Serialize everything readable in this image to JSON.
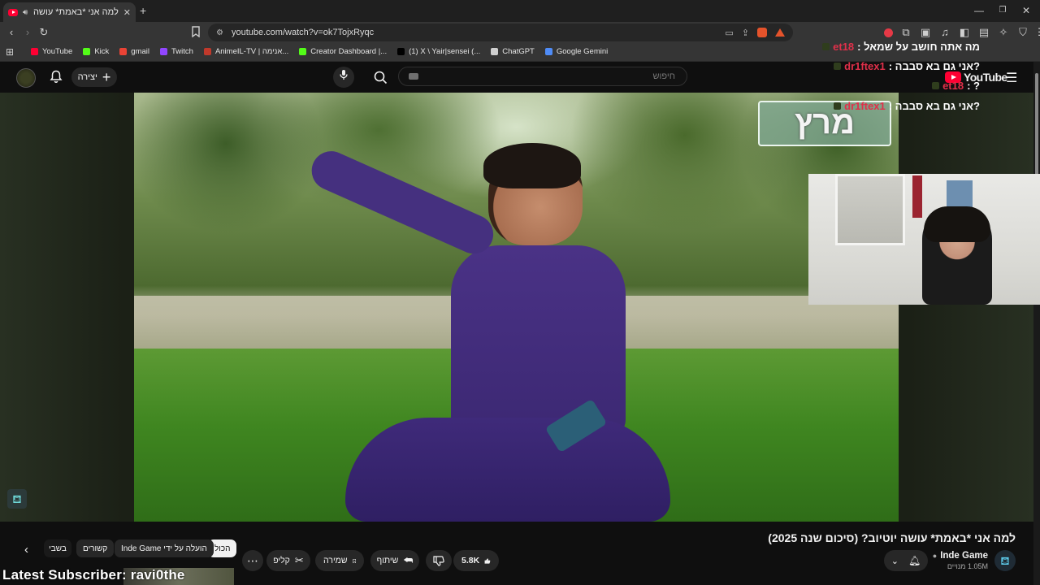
{
  "browser": {
    "tab_title": "למה אני *באמת* עושה יוטיוב?",
    "url": "youtube.com/watch?v=ok7TojxRyqc",
    "bookmarks": [
      {
        "label": "YouTube",
        "icon": "youtube-icon",
        "color": "#ff0033"
      },
      {
        "label": "Kick",
        "icon": "kick-icon",
        "color": "#53fc18"
      },
      {
        "label": "gmail",
        "icon": "gmail-icon",
        "color": "#ea4335"
      },
      {
        "label": "Twitch",
        "icon": "twitch-icon",
        "color": "#9146ff"
      },
      {
        "label": "AnimeIL-TV | אנימה...",
        "icon": "animeil-icon",
        "color": "#c0392b"
      },
      {
        "label": "Creator Dashboard |...",
        "icon": "kick-icon",
        "color": "#53fc18"
      },
      {
        "label": "(1) X \\ Yair|sensei (...",
        "icon": "x-icon",
        "color": "#000000"
      },
      {
        "label": "ChatGPT",
        "icon": "chatgpt-icon",
        "color": "#cfcfcf"
      },
      {
        "label": "Google Gemini",
        "icon": "gemini-icon",
        "color": "#4f8cf7"
      }
    ]
  },
  "youtube": {
    "logo_text": "YouTube",
    "create_label": "יצירה",
    "search_placeholder": "חיפוש"
  },
  "chat": [
    {
      "name": "et18",
      "message": "מה אתה חושב על שמאל :"
    },
    {
      "name": "dr1ftex1",
      "message": "?אני גם בא סבבה :"
    },
    {
      "name": "et18",
      "message": "? :"
    },
    {
      "name": "dr1ftex1",
      "message": "?אני גם בא סבבה :"
    }
  ],
  "video_overlay_text": "מרץ",
  "video": {
    "title": "למה אני *באמת* עושה יוטיוב? (סיכום שנה 2025)",
    "channel_name": "Inde Game",
    "subscribers": "1.05M מנויים",
    "likes": "5.8K",
    "share_label": "שיתוף",
    "save_label": "שמירה",
    "clip_label": "קליפ"
  },
  "chips": [
    "הכול",
    "הועלה על ידי Inde Game",
    "קשורים",
    "בשבי"
  ],
  "stream_overlay": {
    "latest_subscriber": "Latest Subscriber: ravi0the"
  },
  "colors": {
    "accent": "#ff0033",
    "chat_name": "#e0304a"
  }
}
